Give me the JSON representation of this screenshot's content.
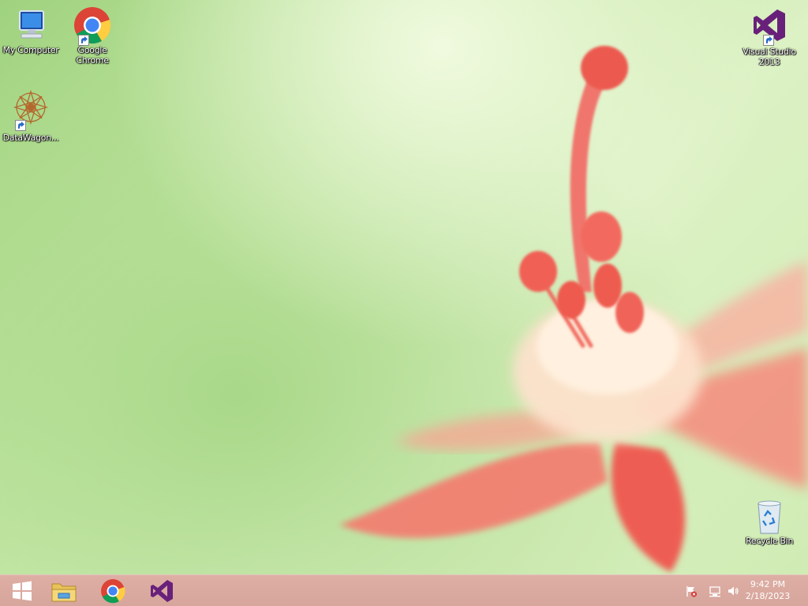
{
  "desktop": {
    "icons": {
      "my_computer": "My Computer",
      "google_chrome": "Google Chrome",
      "datawagon": "DataWagon...",
      "visual_studio": "Visual Studio 2013",
      "recycle_bin": "Recycle Bin"
    }
  },
  "taskbar": {
    "pinned": [
      "start-button",
      "file-explorer-icon",
      "chrome-icon",
      "visual-studio-icon"
    ],
    "tray": [
      "action-center-flag-icon",
      "network-icon",
      "volume-icon"
    ],
    "clock": {
      "time": "9:42 PM",
      "date": "2/18/2023"
    }
  },
  "colors": {
    "taskbar": "#d8a79c",
    "vs_purple": "#68217a",
    "wallpaper_green": "#b9e09a",
    "flower_red": "#f26d63"
  }
}
